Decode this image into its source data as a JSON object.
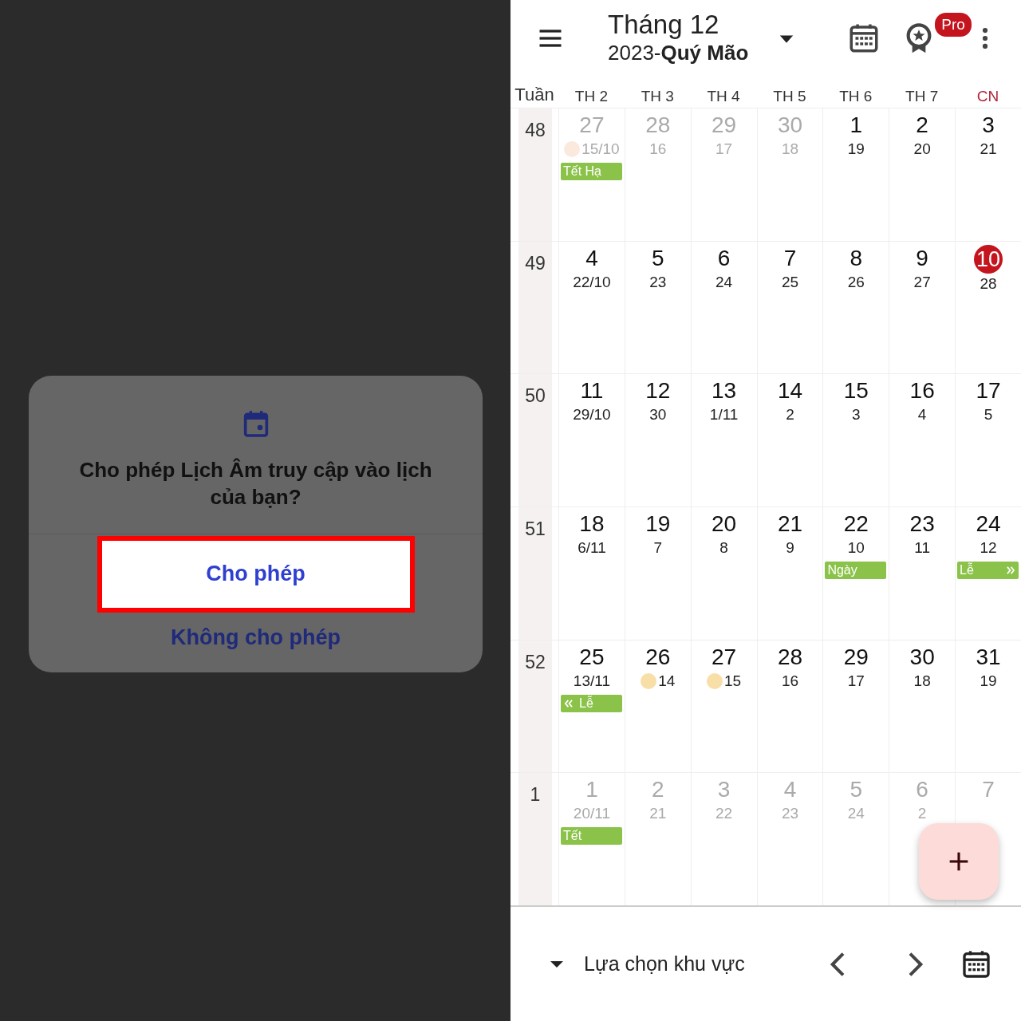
{
  "dialog": {
    "title": "Cho phép Lịch Âm truy cập vào lịch của bạn?",
    "buttons": [
      {
        "label": "Cho phép",
        "kind": "primary",
        "highlighted": true
      },
      {
        "label": "Không cho phép",
        "kind": "secondary",
        "highlighted": false
      }
    ]
  },
  "header": {
    "title": "Tháng 12",
    "subtitle": "2023-**Quý Mão**",
    "badge": "Pro"
  },
  "weekdays": [
    {
      "label": "Tuần",
      "kind": "week",
      "color": "#333333"
    },
    {
      "label": "TH 2",
      "kind": "day",
      "color": "#333333"
    },
    {
      "label": "TH 3",
      "kind": "day",
      "color": "#333333"
    },
    {
      "label": "TH 4",
      "kind": "day",
      "color": "#333333"
    },
    {
      "label": "TH 5",
      "kind": "day",
      "color": "#333333"
    },
    {
      "label": "TH 6",
      "kind": "day",
      "color": "#333333"
    },
    {
      "label": "TH 7",
      "kind": "day",
      "color": "#333333"
    },
    {
      "label": "CN",
      "kind": "day",
      "color": "#b0263a"
    }
  ],
  "weeks": [
    {
      "number": "48",
      "days": [
        {
          "day": "27",
          "lunar": "15/10",
          "in_month": false,
          "today": false,
          "full_moon": true,
          "events": [
            {
              "label": "Tết Hạ",
              "continues_before": false,
              "continues_after": false
            }
          ]
        },
        {
          "day": "28",
          "lunar": "16",
          "in_month": false,
          "today": false,
          "full_moon": false
        },
        {
          "day": "29",
          "lunar": "17",
          "in_month": false,
          "today": false,
          "full_moon": false
        },
        {
          "day": "30",
          "lunar": "18",
          "in_month": false,
          "today": false,
          "full_moon": false
        },
        {
          "day": "1",
          "lunar": "19",
          "in_month": true,
          "today": false,
          "full_moon": false
        },
        {
          "day": "2",
          "lunar": "20",
          "in_month": true,
          "today": false,
          "full_moon": false
        },
        {
          "day": "3",
          "lunar": "21",
          "in_month": true,
          "today": false,
          "full_moon": false
        }
      ]
    },
    {
      "number": "49",
      "days": [
        {
          "day": "4",
          "lunar": "22/10",
          "in_month": true,
          "today": false,
          "full_moon": false
        },
        {
          "day": "5",
          "lunar": "23",
          "in_month": true,
          "today": false,
          "full_moon": false
        },
        {
          "day": "6",
          "lunar": "24",
          "in_month": true,
          "today": false,
          "full_moon": false
        },
        {
          "day": "7",
          "lunar": "25",
          "in_month": true,
          "today": false,
          "full_moon": false
        },
        {
          "day": "8",
          "lunar": "26",
          "in_month": true,
          "today": false,
          "full_moon": false
        },
        {
          "day": "9",
          "lunar": "27",
          "in_month": true,
          "today": false,
          "full_moon": false
        },
        {
          "day": "10",
          "lunar": "28",
          "in_month": true,
          "today": true,
          "full_moon": false
        }
      ]
    },
    {
      "number": "50",
      "days": [
        {
          "day": "11",
          "lunar": "29/10",
          "in_month": true,
          "today": false,
          "full_moon": false
        },
        {
          "day": "12",
          "lunar": "30",
          "in_month": true,
          "today": false,
          "full_moon": false
        },
        {
          "day": "13",
          "lunar": "1/11",
          "in_month": true,
          "today": false,
          "full_moon": false
        },
        {
          "day": "14",
          "lunar": "2",
          "in_month": true,
          "today": false,
          "full_moon": false
        },
        {
          "day": "15",
          "lunar": "3",
          "in_month": true,
          "today": false,
          "full_moon": false
        },
        {
          "day": "16",
          "lunar": "4",
          "in_month": true,
          "today": false,
          "full_moon": false
        },
        {
          "day": "17",
          "lunar": "5",
          "in_month": true,
          "today": false,
          "full_moon": false
        }
      ]
    },
    {
      "number": "51",
      "days": [
        {
          "day": "18",
          "lunar": "6/11",
          "in_month": true,
          "today": false,
          "full_moon": false
        },
        {
          "day": "19",
          "lunar": "7",
          "in_month": true,
          "today": false,
          "full_moon": false
        },
        {
          "day": "20",
          "lunar": "8",
          "in_month": true,
          "today": false,
          "full_moon": false
        },
        {
          "day": "21",
          "lunar": "9",
          "in_month": true,
          "today": false,
          "full_moon": false
        },
        {
          "day": "22",
          "lunar": "10",
          "in_month": true,
          "today": false,
          "full_moon": false,
          "events": [
            {
              "label": "Ngày",
              "continues_before": false,
              "continues_after": false
            }
          ]
        },
        {
          "day": "23",
          "lunar": "11",
          "in_month": true,
          "today": false,
          "full_moon": false
        },
        {
          "day": "24",
          "lunar": "12",
          "in_month": true,
          "today": false,
          "full_moon": false,
          "events": [
            {
              "label": "Lễ",
              "continues_before": false,
              "continues_after": true
            }
          ]
        }
      ]
    },
    {
      "number": "52",
      "days": [
        {
          "day": "25",
          "lunar": "13/11",
          "in_month": true,
          "today": false,
          "full_moon": false,
          "events": [
            {
              "label": "Lễ",
              "continues_before": true,
              "continues_after": false
            }
          ]
        },
        {
          "day": "26",
          "lunar": "14",
          "in_month": true,
          "today": false,
          "full_moon": true
        },
        {
          "day": "27",
          "lunar": "15",
          "in_month": true,
          "today": false,
          "full_moon": true
        },
        {
          "day": "28",
          "lunar": "16",
          "in_month": true,
          "today": false,
          "full_moon": false
        },
        {
          "day": "29",
          "lunar": "17",
          "in_month": true,
          "today": false,
          "full_moon": false
        },
        {
          "day": "30",
          "lunar": "18",
          "in_month": true,
          "today": false,
          "full_moon": false
        },
        {
          "day": "31",
          "lunar": "19",
          "in_month": true,
          "today": false,
          "full_moon": false
        }
      ]
    },
    {
      "number": "1",
      "days": [
        {
          "day": "1",
          "lunar": "20/11",
          "in_month": false,
          "today": false,
          "full_moon": false,
          "events": [
            {
              "label": "Tết",
              "continues_before": false,
              "continues_after": false
            }
          ]
        },
        {
          "day": "2",
          "lunar": "21",
          "in_month": false,
          "today": false,
          "full_moon": false
        },
        {
          "day": "3",
          "lunar": "22",
          "in_month": false,
          "today": false,
          "full_moon": false
        },
        {
          "day": "4",
          "lunar": "23",
          "in_month": false,
          "today": false,
          "full_moon": false
        },
        {
          "day": "5",
          "lunar": "24",
          "in_month": false,
          "today": false,
          "full_moon": false
        },
        {
          "day": "6",
          "lunar": "2",
          "in_month": false,
          "today": false,
          "full_moon": false
        },
        {
          "day": "7",
          "in_month": false,
          "today": false
        }
      ]
    }
  ],
  "bottom_bar": {
    "region_label": "Lựa chọn khu vực"
  }
}
